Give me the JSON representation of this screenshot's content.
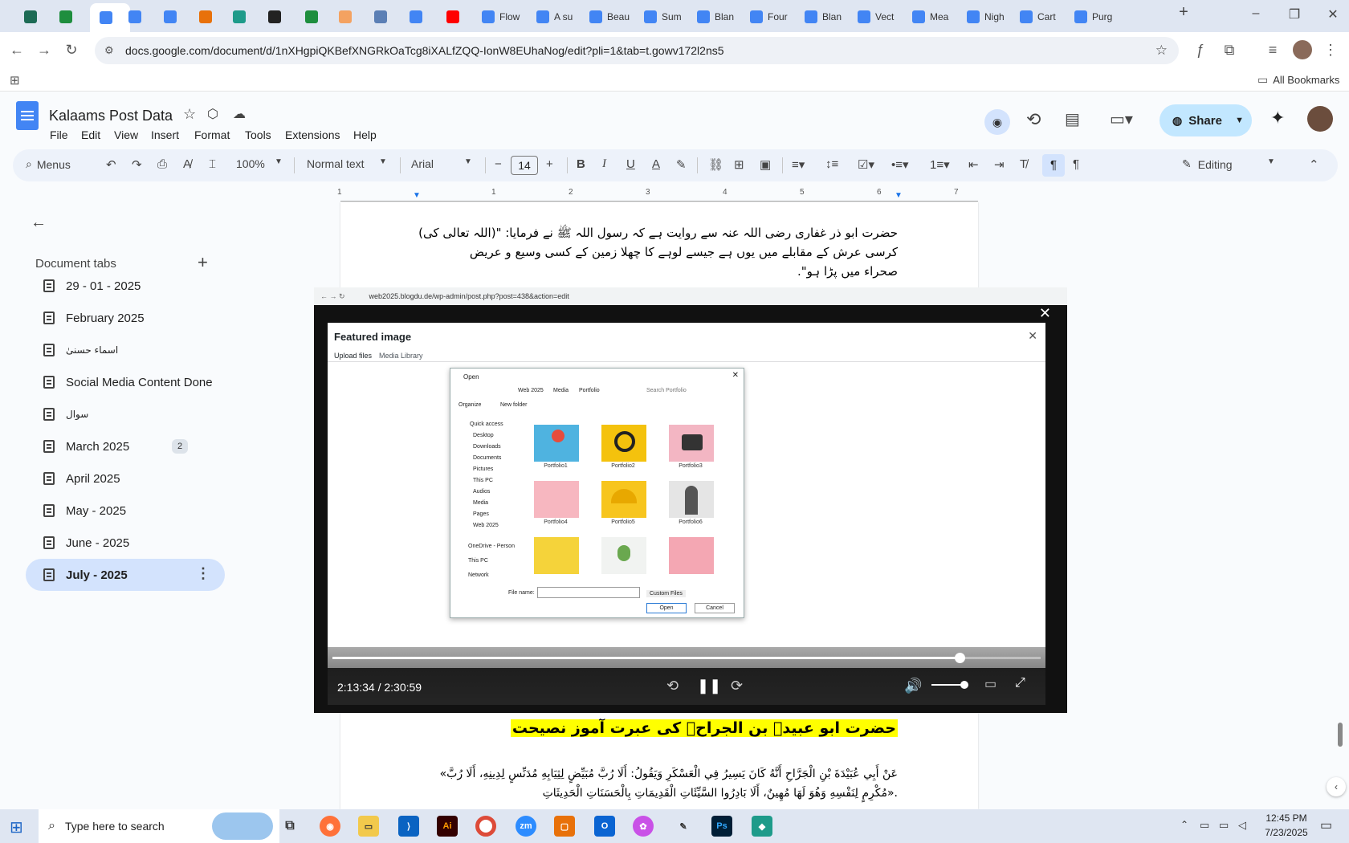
{
  "browser": {
    "tabs": [
      {
        "label": "",
        "icon": "vpn-icon",
        "color": "#1d6b55"
      },
      {
        "label": "",
        "icon": "sheets-icon",
        "color": "#1e8e3e"
      },
      {
        "label": "",
        "icon": "docs-icon",
        "color": "#4285f4"
      },
      {
        "label": "",
        "icon": "docs-icon",
        "color": "#4285f4"
      },
      {
        "label": "",
        "icon": "docs-icon",
        "color": "#4285f4"
      },
      {
        "label": "",
        "icon": "slides-icon",
        "color": "#e8710a"
      },
      {
        "label": "",
        "icon": "extension-icon",
        "color": "#1e9b8a"
      },
      {
        "label": "",
        "icon": "openai-icon",
        "color": "#222222"
      },
      {
        "label": "",
        "icon": "sheets-icon",
        "color": "#1e8e3e"
      },
      {
        "label": "",
        "icon": "hand-icon",
        "color": "#f4a261"
      },
      {
        "label": "",
        "icon": "grid-icon",
        "color": "#5b7fb5"
      },
      {
        "label": "",
        "icon": "docs-icon",
        "color": "#4285f4"
      },
      {
        "label": "",
        "icon": "youtube-icon",
        "color": "#ff0000"
      },
      {
        "label": "Flow",
        "icon": "docs-icon",
        "color": "#4285f4"
      },
      {
        "label": "A su",
        "icon": "docs-icon",
        "color": "#4285f4"
      },
      {
        "label": "Beau",
        "icon": "docs-icon",
        "color": "#4285f4"
      },
      {
        "label": "Sum",
        "icon": "docs-icon",
        "color": "#4285f4"
      },
      {
        "label": "Blan",
        "icon": "docs-icon",
        "color": "#4285f4"
      },
      {
        "label": "Four",
        "icon": "docs-icon",
        "color": "#4285f4"
      },
      {
        "label": "Blan",
        "icon": "docs-icon",
        "color": "#4285f4"
      },
      {
        "label": "Vect",
        "icon": "docs-icon",
        "color": "#4285f4"
      },
      {
        "label": "Mea",
        "icon": "docs-icon",
        "color": "#4285f4"
      },
      {
        "label": "Nigh",
        "icon": "docs-icon",
        "color": "#4285f4"
      },
      {
        "label": "Cart",
        "icon": "docs-icon",
        "color": "#4285f4"
      },
      {
        "label": "Purg",
        "icon": "docs-icon",
        "color": "#4285f4"
      }
    ],
    "url": "docs.google.com/document/d/1nXHgpiQKBefXNGRkOaTcg8iXALfZQQ-IonW8EUhaNog/edit?pli=1&tab=t.gowv172l2ns5",
    "all_bookmarks": "All Bookmarks"
  },
  "docs": {
    "title": "Kalaams Post Data",
    "menus": [
      "File",
      "Edit",
      "View",
      "Insert",
      "Format",
      "Tools",
      "Extensions",
      "Help"
    ],
    "share_label": "Share",
    "toolbar": {
      "menus_search": "Menus",
      "zoom": "100%",
      "style": "Normal text",
      "font": "Arial",
      "font_size": "14",
      "editing_mode": "Editing"
    },
    "ruler_ticks": [
      "1",
      "1",
      "2",
      "3",
      "4",
      "5",
      "6",
      "7"
    ]
  },
  "sidebar": {
    "heading": "Document tabs",
    "tabs": [
      {
        "label": "29 - 01 - 2025",
        "badge": ""
      },
      {
        "label": "February 2025",
        "badge": ""
      },
      {
        "label": "اسماء حسنیٰ",
        "badge": ""
      },
      {
        "label": "Social Media Content Done",
        "badge": ""
      },
      {
        "label": "سوال",
        "badge": ""
      },
      {
        "label": "March 2025",
        "badge": "2"
      },
      {
        "label": "April 2025",
        "badge": ""
      },
      {
        "label": "May - 2025",
        "badge": ""
      },
      {
        "label": "June - 2025",
        "badge": ""
      },
      {
        "label": "July - 2025",
        "badge": "",
        "active": true
      }
    ]
  },
  "page": {
    "para1_line1": "حضرت ابو ذر غفاری رضی اللہ عنہ سے روایت ہے کہ رسول اللہ ﷺ نے فرمایا: \"(اللہ تعالی کی)",
    "para1_line2": "کرسی عرش کے مقابلے میں یوں ہے جیسے لوہے کا چھلا زمین کے کسی وسیع و عریض",
    "para1_line3": "صحراء میں پڑا ہو\".",
    "heading2": "حضرت ابو عبیدہ بن الجراحؓ کی عبرت آموز نصیحت",
    "para2_line1": "عَنْ أَبِي عُبَيْدَةَ بْنِ الْجَرَّاحِ أَنَّهُ كَانَ يَسِيرُ فِي الْعَسْكَرِ وَيَقُولُ: أَلَا رُبَّ مُبَيِّضٍ لِثِيَابِهِ مُدَنِّسٍ لِدِينِهِ، أَلَا رُبَّ»",
    "para2_line2": ".«مُكْرِمٍ لِنَفْسِهِ وَهُوَ لَهَا مُهِينٌ، أَلَا بَادِرُوا السَّيِّئَاتِ الْقَدِيمَاتِ بِالْحَسَنَاتِ الْحَدِيثَاتِ"
  },
  "video": {
    "inner_url": "web2025.blogdu.de/wp-admin/post.php?post=438&action=edit",
    "modal_title": "Featured image",
    "modal_tabs": [
      "Upload files",
      "Media Library"
    ],
    "dialog": {
      "title": "Open",
      "breadcrumb": [
        "Web 2025",
        "Media",
        "Portfolio"
      ],
      "search_placeholder": "Search Portfolio",
      "organize": "Organize",
      "new_folder": "New folder",
      "nav": [
        "Quick access",
        "Desktop",
        "Downloads",
        "Documents",
        "Pictures",
        "This PC",
        "Audios",
        "Media",
        "Pages",
        "Web 2025",
        "OneDrive - Person",
        "This PC",
        "Network"
      ],
      "files": [
        "Portfolio1",
        "Portfolio2",
        "Portfolio3",
        "Portfolio4",
        "Portfolio5",
        "Portfolio6"
      ],
      "file_name_label": "File name:",
      "file_type": "Custom Files",
      "open_btn": "Open",
      "cancel_btn": "Cancel"
    },
    "time": "2:13:34 / 2:30:59",
    "progress": 0.885
  },
  "taskbar": {
    "search_placeholder": "Type here to search",
    "time": "12:45 PM",
    "date": "7/23/2025"
  }
}
